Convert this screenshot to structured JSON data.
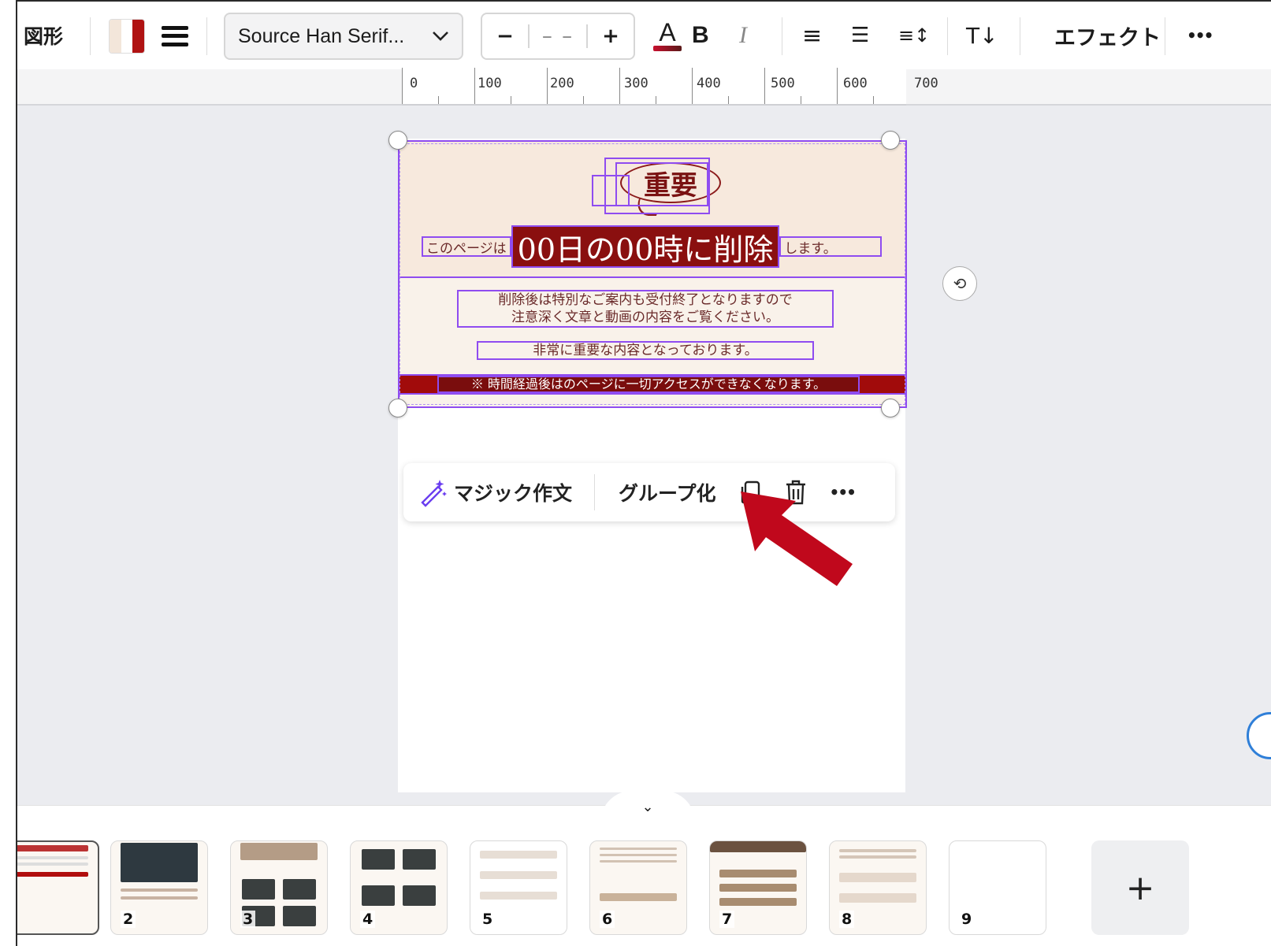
{
  "toolbar": {
    "shape_label": "図形",
    "font_name": "Source Han Serif...",
    "size_minus": "−",
    "size_value": "– –",
    "size_plus": "+",
    "text_color_glyph": "A",
    "bold_glyph": "B",
    "italic_glyph": "I",
    "align_glyph": "≡",
    "list_glyph": "☰",
    "spacing_glyph": "≡↕",
    "vertical_text_glyph": "T↓",
    "effect_label": "エフェクト",
    "more_glyph": "•••",
    "swatch_colors": [
      "#f3e6da",
      "#ffffff",
      "#b01212"
    ]
  },
  "ruler": {
    "ticks": [
      "0",
      "100",
      "200",
      "300",
      "400",
      "500",
      "600",
      "700"
    ]
  },
  "design": {
    "badge": "重要",
    "headline_pre": "このページは",
    "headline_main": "00日の00時に削除",
    "headline_post": "します。",
    "paragraph_line1": "削除後は特別なご案内も受付終了となりますので",
    "paragraph_line2": "注意深く文章と動画の内容をご覧ください。",
    "note": "非常に重要な内容となっております。",
    "warning": "※ 時間経過後はのページに一切アクセスができなくなります。",
    "accent_color": "#8a0f0f"
  },
  "context_menu": {
    "magic_write": "マジック作文",
    "group": "グループ化",
    "copy_icon": "copy-icon",
    "delete_icon": "trash-icon",
    "more": "•••"
  },
  "pages": [
    {
      "num": ""
    },
    {
      "num": "2"
    },
    {
      "num": "3"
    },
    {
      "num": "4"
    },
    {
      "num": "5"
    },
    {
      "num": "6"
    },
    {
      "num": "7"
    },
    {
      "num": "8"
    },
    {
      "num": "9"
    }
  ],
  "add_page": "+",
  "collapse_glyph": "⌄",
  "rotate_glyph": "⟲"
}
